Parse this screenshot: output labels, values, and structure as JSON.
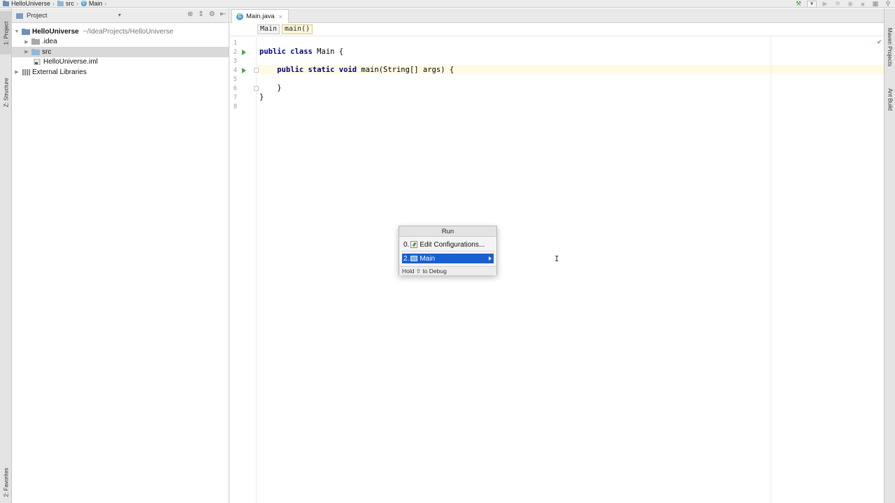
{
  "breadcrumbs": [
    "HelloUniverse",
    "src",
    "Main"
  ],
  "left_tabs": {
    "project": "1: Project",
    "structure": "Z: Structure",
    "favorites": "2: Favorites"
  },
  "right_tabs": {
    "maven": "Maven Projects",
    "ant": "Ant Build"
  },
  "project_panel": {
    "title": "Project",
    "tree": [
      {
        "label": "HelloUniverse",
        "path": "~/IdeaProjects/HelloUniverse"
      },
      {
        "label": ".idea"
      },
      {
        "label": "src"
      },
      {
        "label": "HelloUniverse.iml"
      },
      {
        "label": "External Libraries"
      }
    ]
  },
  "editor": {
    "tab": "Main.java",
    "crumbs": [
      "Main",
      "main()"
    ],
    "line_numbers": [
      "1",
      "2",
      "3",
      "4",
      "5",
      "6",
      "7",
      "8"
    ]
  },
  "run_popup": {
    "title": "Run",
    "items": [
      {
        "num": "0.",
        "label": "Edit Configurations..."
      },
      {
        "num": "2.",
        "label": "Main"
      }
    ],
    "footer": "Hold ⇧ to Debug"
  },
  "colors": {
    "selection": "#1a5fd0",
    "keyword": "#000080",
    "run_gutter": "#3fae3f",
    "caret_row": "#fffae3"
  }
}
